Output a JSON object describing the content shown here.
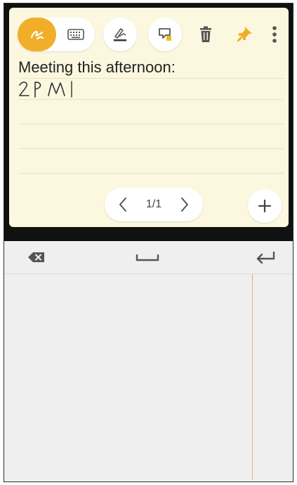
{
  "toolbar": {
    "icons": {
      "pen_mode": "pen-handwriting-icon",
      "keyboard_mode": "keyboard-icon",
      "pen_settings": "pen-settings-icon",
      "convert": "convert-to-text-icon",
      "delete": "trash-icon",
      "pin": "pin-icon",
      "more": "more-vertical-icon"
    }
  },
  "memo": {
    "title": "Meeting this afternoon:",
    "handwritten_text": "2PM"
  },
  "pager": {
    "page_label": "1/1",
    "prev": "‹",
    "next": "›"
  },
  "add_label": "+",
  "keys": {
    "backspace": "backspace-icon",
    "space": "space-icon",
    "enter": "enter-icon"
  },
  "colors": {
    "accent": "#f1ae2b",
    "memo_background": "#fbf8df",
    "input_background": "#efefef",
    "cursor": "#f2a67d"
  }
}
